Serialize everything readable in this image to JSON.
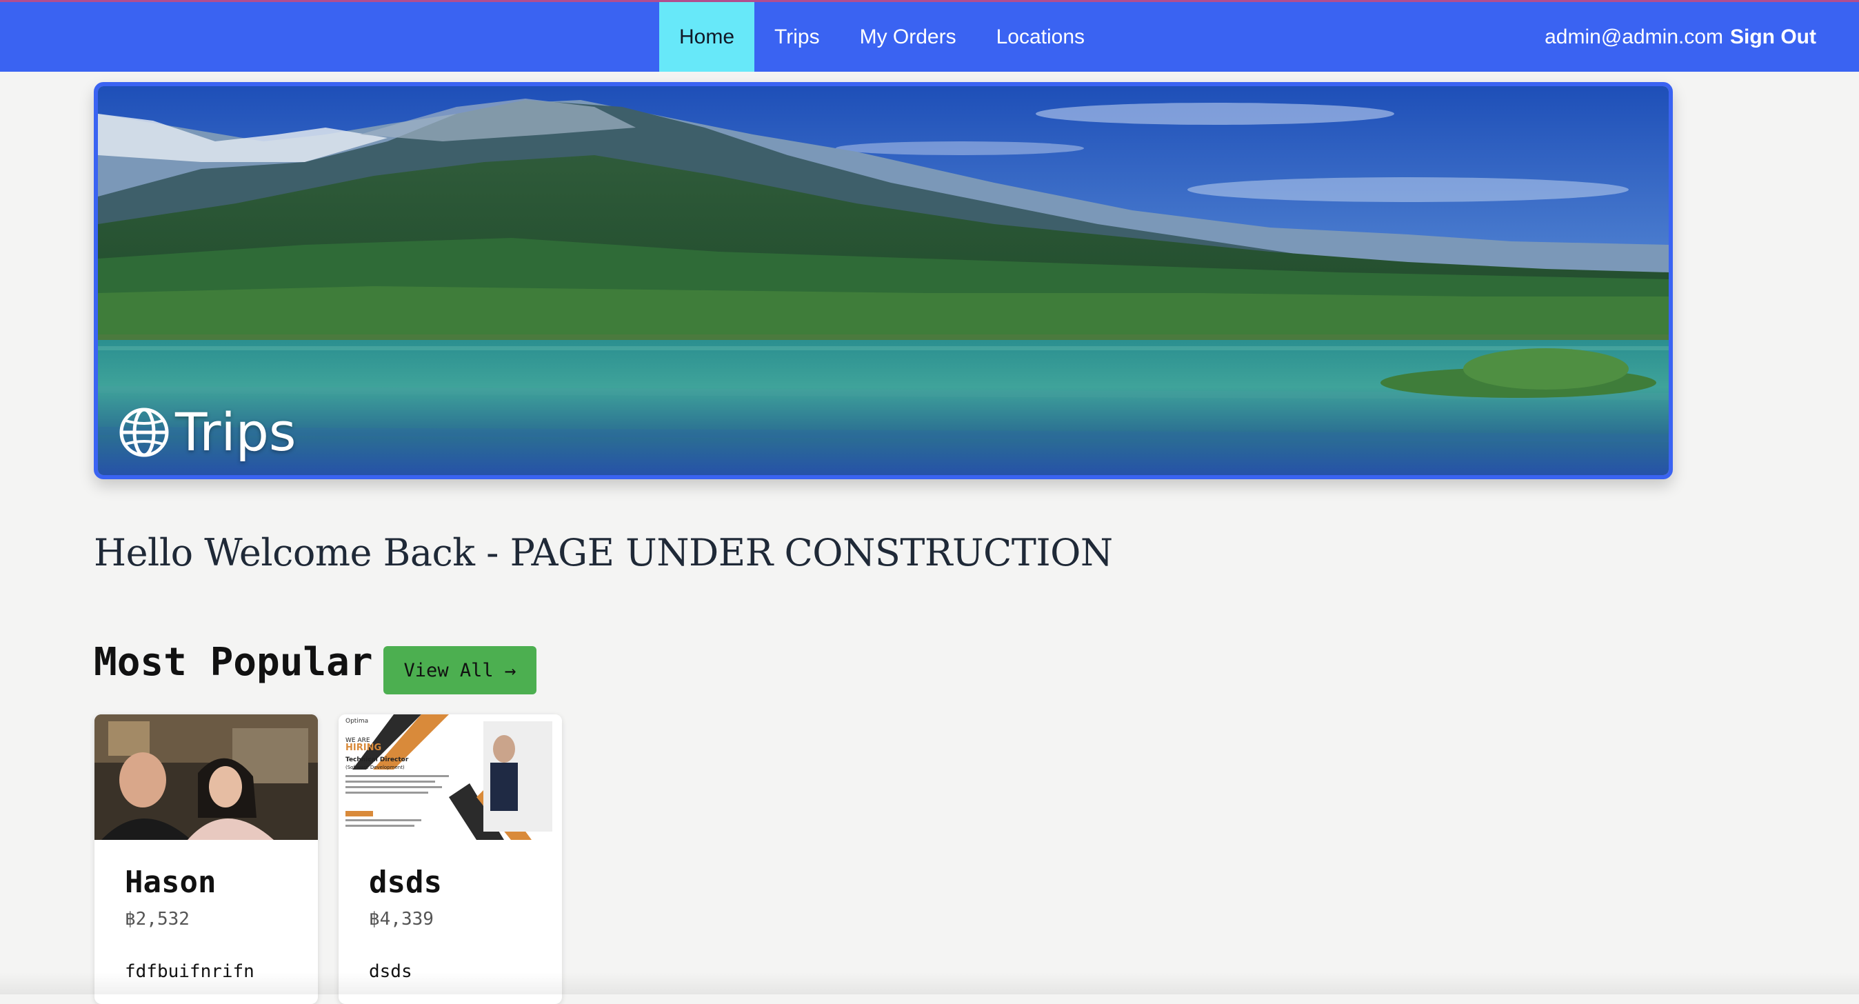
{
  "nav": {
    "links": [
      "Home",
      "Trips",
      "My Orders",
      "Locations"
    ],
    "active": "Home",
    "user_email": "admin@admin.com",
    "signout_label": "Sign Out",
    "colors": {
      "bar": "#3a63f2",
      "active_bg": "#67e8f9"
    }
  },
  "hero": {
    "title": "Trips",
    "icon": "globe-icon"
  },
  "welcome_text": "Hello Welcome Back - PAGE UNDER CONSTRUCTION",
  "popular": {
    "title": "Most Popular",
    "view_all_label": "View All",
    "view_all_icon": "arrow-right-icon",
    "view_all_color": "#4caf50",
    "cards": [
      {
        "name": "Hason",
        "price": "฿2,532",
        "description": "fdfbuifnrifn"
      },
      {
        "name": "dsds",
        "price": "฿4,339",
        "description": "dsds"
      }
    ],
    "card_images": {
      "poster_text": {
        "brand": "Optima",
        "line1": "WE ARE",
        "line2": "HIRING",
        "line3": "Technical Director",
        "line4": "(Software Development)"
      }
    }
  }
}
